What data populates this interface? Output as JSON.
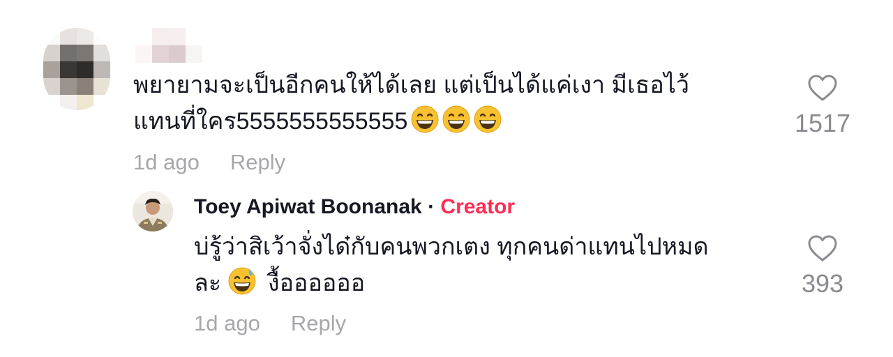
{
  "comment": {
    "line1": "พยายามจะเป็นอีกคนให้ได้เลย แต่เป็นได้แค่เงา มีเธอไว้",
    "line2_text": "แทนที่ใคร5555555555555",
    "time": "1d ago",
    "reply_label": "Reply",
    "likes": "1517"
  },
  "reply": {
    "author": "Toey Apiwat Boonanak",
    "separator": "·",
    "badge": "Creator",
    "line1": "บ่รู้ว่าสิเว้าจั่งได๋กับคนพวกเตง ทุกคนด่าแทนไปหมด",
    "line2_before": "ละ",
    "line2_after": "งื้ออออออ",
    "time": "1d ago",
    "reply_label": "Reply",
    "likes": "393"
  },
  "icons": {
    "like": "heart-outline-icon",
    "emoji_grin": "grinning-face-emoji",
    "emoji_sweat": "grinning-face-with-sweat-emoji"
  },
  "colors": {
    "creator_badge": "#fe2c55",
    "meta_text": "#a7a7ab",
    "like_count": "#8a8b91"
  }
}
